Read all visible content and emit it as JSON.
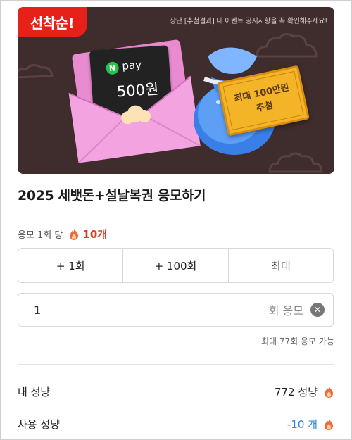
{
  "banner": {
    "badge": "선착순!",
    "notice": "상단 [추첨결과] 내 이벤트 공지사항을 꼭 확인해주세요!",
    "card_brand_letter": "N",
    "card_brand_word": "pay",
    "card_amount": "500원",
    "ticket_line1": "최대 100만원",
    "ticket_line2": "추첨"
  },
  "title": "2025 세뱃돈+설날복권 응모하기",
  "cost": {
    "label": "응모 1회 당",
    "amount": "10개"
  },
  "quick_buttons": [
    "+ 1회",
    "+ 100회",
    "최대"
  ],
  "count_input": {
    "value": "1",
    "unit": "회 응모"
  },
  "max_note": "최대 77회 응모 가능",
  "stats": {
    "my_label": "내 성냥",
    "my_value": "772 성냥",
    "use_label": "사용 성냥",
    "use_value": "-10 개"
  },
  "colors": {
    "accent_red": "#e8201a",
    "cost_red": "#e03b23",
    "blue": "#2a86d8",
    "banner_bg": "#3f2c2d"
  }
}
